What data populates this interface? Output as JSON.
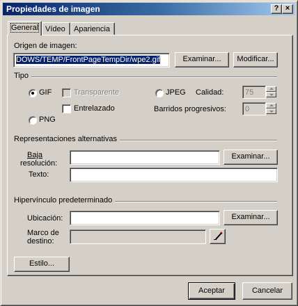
{
  "window": {
    "title": "Propiedades de imagen",
    "help_glyph": "?",
    "close_glyph": "×"
  },
  "tabs": [
    {
      "label": "General",
      "active": true
    },
    {
      "label": "Vídeo",
      "active": false
    },
    {
      "label": "Apariencia",
      "active": false
    }
  ],
  "origin": {
    "label": "Origen de imagen:",
    "value": "DOWS/TEMP/FrontPageTempDir/wpe2.gif",
    "browse_label": "Examinar...",
    "modify_label": "Modificar..."
  },
  "tipo": {
    "title": "Tipo",
    "gif_label": "GIF",
    "png_label": "PNG",
    "jpeg_label": "JPEG",
    "selected": "GIF",
    "transparente_label": "Transparente",
    "entrelazado_label": "Entrelazado",
    "calidad_label": "Calidad:",
    "calidad_value": "75",
    "barridos_label": "Barridos progresivos:",
    "barridos_value": "0"
  },
  "alternativas": {
    "title": "Representaciones alternativas",
    "baja_label_1": "Baja",
    "baja_label_2": "resolución:",
    "baja_value": "",
    "texto_label": "Texto:",
    "texto_value": "",
    "browse_label": "Examinar..."
  },
  "hipervinculo": {
    "title": "Hipervínculo predeterminado",
    "ubicacion_label": "Ubicación:",
    "ubicacion_value": "",
    "browse_label": "Examinar...",
    "marco_label_1": "Marco de",
    "marco_label_2": "destino:",
    "marco_value": ""
  },
  "estilo_label": "Estilo...",
  "footer": {
    "ok_label": "Aceptar",
    "cancel_label": "Cancelar"
  }
}
